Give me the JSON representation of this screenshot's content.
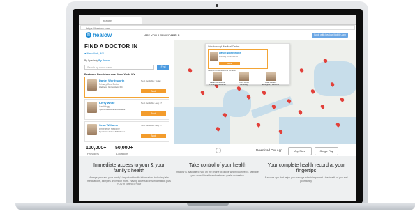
{
  "browser": {
    "tab_title": "healow",
    "url": "https://healow.com"
  },
  "header": {
    "logo_text": "healow",
    "nav": [
      "ARE YOU A PROVIDER?",
      "HELP"
    ],
    "button_label": "Book with healow Mobile App"
  },
  "search": {
    "title": "FIND A DOCTOR IN",
    "location": "New York, NY",
    "by_label": "By Specialty",
    "by_value": "By Doctor",
    "placeholder": "Search by doctor name",
    "button": "Find",
    "featured_heading": "Featured Providers near New York, NY"
  },
  "doctors": [
    {
      "name": "Daniel Wordsworth",
      "specialty": "Primary Care Doctor",
      "address": "Wellness Gynecology PC",
      "availability": "Next Available: Today",
      "book": "Book"
    },
    {
      "name": "Kerry White",
      "specialty": "Cardiology",
      "address": "Sports Medicine & Wellness",
      "availability": "Next Available: Aug 17",
      "book": "Book"
    },
    {
      "name": "Sean Williams",
      "specialty": "Emergency Medicine",
      "address": "Sports Medicine & Wellness",
      "availability": "Next Available: Aug 17",
      "book": "Book"
    }
  ],
  "map_popup": {
    "title": "Westborough Medical Center",
    "doctor_name": "Daniel Wordsworth",
    "doctor_specialty": "Primary Care Doctor",
    "book": "Book",
    "more_label": "More Providers at this location",
    "mini_doctors": [
      "Daniel Wordsworth Primary Care Doctor",
      "Kerry White Cardiology",
      "Sean Williams Emergency Medicine"
    ]
  },
  "stats": [
    {
      "number": "100,000+",
      "label": "Providers"
    },
    {
      "number": "50,000+",
      "label": "Locations"
    }
  ],
  "download": {
    "label": "Download Our App",
    "app_store": "App Store",
    "google_play": "Google Play"
  },
  "features": [
    {
      "title": "Immediate access to your & your family's health",
      "text": "Manage your and your family's important health information, including labs, medications, allergies and much more. Having access to this information puts YOU in control of your"
    },
    {
      "title": "Take control of your health",
      "text": "healow is available to you on the phone or online when you need it. Manage your overall health and wellness goals on healow."
    },
    {
      "title": "Your complete health record at your fingertips",
      "text": "A secure app that helps you manage what's important - the health of you and your family!"
    }
  ]
}
